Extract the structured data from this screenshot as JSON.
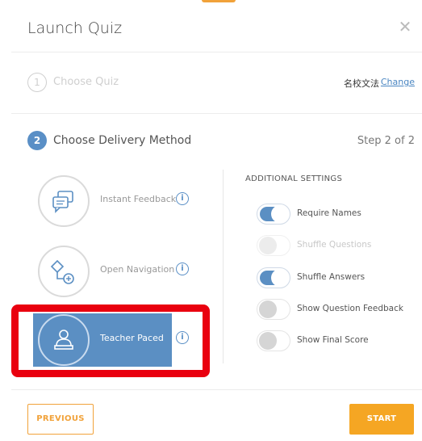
{
  "modal": {
    "title": "Launch Quiz",
    "close_icon": "close-icon",
    "accent_color": "#f1a23a"
  },
  "step1": {
    "number": "1",
    "label": "Choose Quiz",
    "quiz_name": "名校文法",
    "change_label": "Change"
  },
  "step2": {
    "number": "2",
    "label": "Choose Delivery Method",
    "step_text": "Step 2 of 2"
  },
  "methods": [
    {
      "label": "Instant Feedback",
      "icon": "chat-feedback-icon",
      "info": "i",
      "selected": false
    },
    {
      "label": "Open Navigation",
      "icon": "navigation-icon",
      "info": "i",
      "selected": false
    },
    {
      "label": "Teacher Paced",
      "icon": "teacher-icon",
      "info": "i",
      "selected": true
    }
  ],
  "settings": {
    "title": "ADDITIONAL SETTINGS",
    "items": [
      {
        "label": "Require Names",
        "on": true,
        "disabled": false
      },
      {
        "label": "Shuffle Questions",
        "on": false,
        "disabled": true
      },
      {
        "label": "Shuffle Answers",
        "on": true,
        "disabled": false
      },
      {
        "label": "Show Question Feedback",
        "on": false,
        "disabled": false
      },
      {
        "label": "Show Final Score",
        "on": false,
        "disabled": false
      }
    ]
  },
  "footer": {
    "previous_label": "PREVIOUS",
    "start_label": "START"
  },
  "colors": {
    "primary_blue": "#5b8fc3",
    "orange": "#f5a623",
    "highlight_red": "#e9000f"
  }
}
